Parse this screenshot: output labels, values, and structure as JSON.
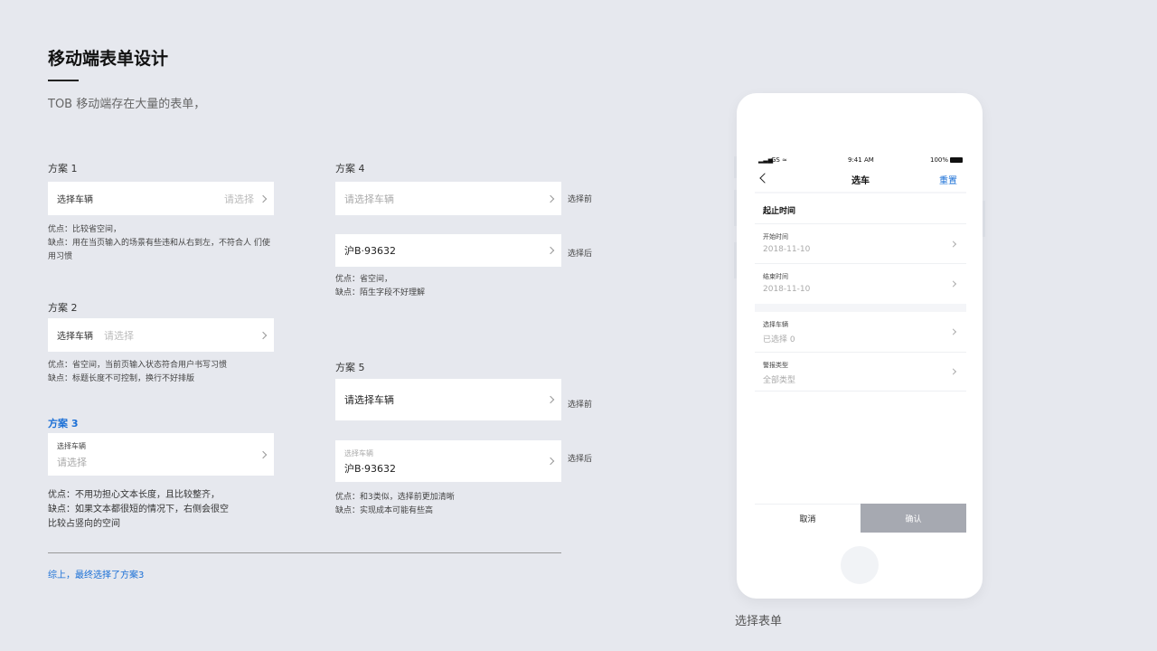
{
  "header": {
    "title": "移动端表单设计",
    "subtitle": "TOB 移动端存在大量的表单，"
  },
  "s1": {
    "label": "方案 1",
    "field_label": "选择车辆",
    "placeholder": "请选择",
    "pros": "优点：比较省空间，",
    "cons": "缺点：用在当页输入的场景有些违和从右到左，不符合人 们使",
    "cons2": "用习惯"
  },
  "s2": {
    "label": "方案 2",
    "field_label": "选择车辆",
    "placeholder": "请选择",
    "pros": "优点：省空间，当前页输入状态符合用户书写习惯",
    "cons": "缺点：标题长度不可控制，换行不好排版"
  },
  "s3": {
    "label": "方案 3",
    "field_label": "选择车辆",
    "placeholder": "请选择",
    "pros": "优点：不用功担心文本长度，且比较整齐，",
    "cons": "缺点：如果文本都很短的情况下，右侧会很空",
    "cons2": "比较占竖向的空间"
  },
  "s4": {
    "label": "方案 4",
    "before_placeholder": "请选择车辆",
    "before_tag": "选择前",
    "after_value": "沪B·93632",
    "after_tag": "选择后",
    "pros": "优点：省空间，",
    "cons": "缺点：陌生字段不好理解"
  },
  "s5": {
    "label": "方案 5",
    "before_value": "请选择车辆",
    "before_tag": "选择前",
    "after_label": "选择车辆",
    "after_value": "沪B·93632",
    "after_tag": "选择后",
    "pros": "优点：和3类似，选择前更加清晰",
    "cons": "缺点：实现成本可能有些高"
  },
  "conclusion": "综上，最终选择了方案3",
  "phone": {
    "status": {
      "carrier": "GS",
      "time": "9:41 AM",
      "battery": "100%"
    },
    "nav": {
      "title": "选车",
      "reset": "重置"
    },
    "section_title": "起止时间",
    "start": {
      "label": "开始时间",
      "value": "2018-11-10"
    },
    "end": {
      "label": "结束时间",
      "value": "2018-11-10"
    },
    "vehicle": {
      "label": "选择车辆",
      "value": "已选择 0"
    },
    "alarm": {
      "label": "警报类型",
      "value": "全部类型"
    },
    "cancel": "取消",
    "confirm": "确认",
    "caption": "选择表单"
  }
}
